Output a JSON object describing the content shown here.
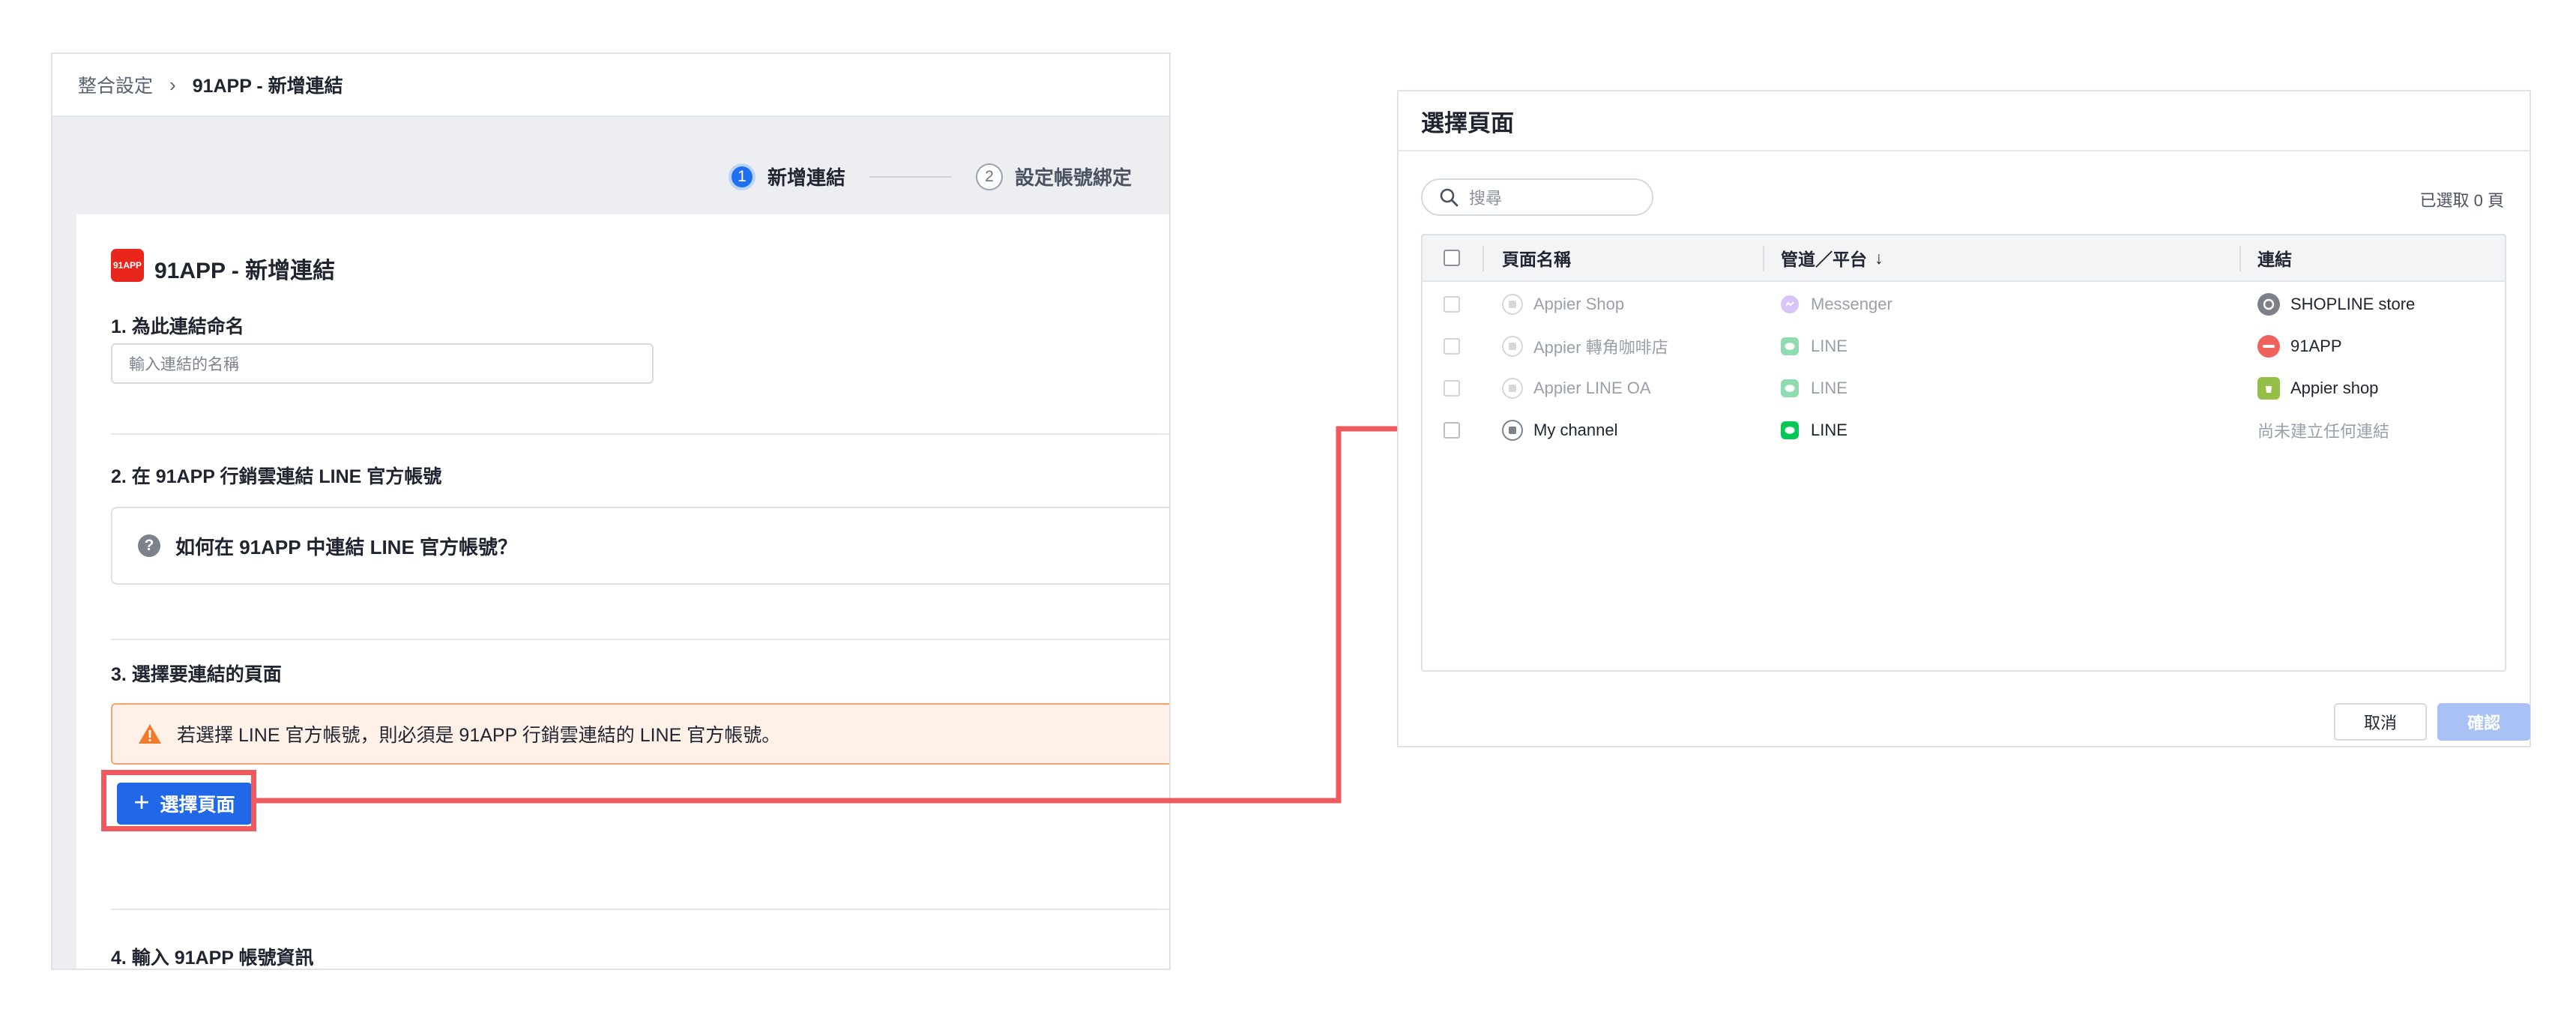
{
  "left_panel": {
    "breadcrumb": {
      "parent": "整合設定",
      "separator": "›",
      "current": "91APP - 新增連結"
    },
    "stepper": [
      {
        "num": "1",
        "label": "新增連結"
      },
      {
        "num": "2",
        "label": "設定帳號綁定"
      }
    ],
    "card": {
      "logo_text": "91APP",
      "title": "91APP - 新增連結",
      "section1_label": "1. 為此連結命名",
      "name_placeholder": "輸入連結的名稱",
      "section2_label": "2. 在 91APP 行銷雲連結 LINE 官方帳號",
      "help_text": "如何在 91APP 中連結 LINE 官方帳號？",
      "section3_label": "3. 選擇要連結的頁面",
      "warning_text": "若選擇 LINE 官方帳號，則必須是 91APP 行銷雲連結的 LINE 官方帳號。",
      "select_button": "選擇頁面",
      "section4_label": "4. 輸入 91APP 帳號資訊"
    }
  },
  "modal": {
    "title": "選擇頁面",
    "search_placeholder": "搜尋",
    "selected_count": "已選取 0 頁",
    "columns": {
      "page_name": "頁面名稱",
      "channel": "管道／平台",
      "sort_arrow": "↓",
      "connection": "連結"
    },
    "rows": [
      {
        "page": "Appier Shop",
        "channel": "Messenger",
        "channel_icon": "messenger-icon",
        "connection": "SHOPLINE store",
        "connection_icon": "shopline-icon",
        "disabled": true
      },
      {
        "page": "Appier 轉角咖啡店",
        "channel": "LINE",
        "channel_icon": "line-icon",
        "connection": "91APP",
        "connection_icon": "91app-icon",
        "disabled": true
      },
      {
        "page": "Appier LINE OA",
        "channel": "LINE",
        "channel_icon": "line-icon",
        "connection": "Appier shop",
        "connection_icon": "shopify-icon",
        "disabled": true
      },
      {
        "page": "My channel",
        "channel": "LINE",
        "channel_icon": "line-icon",
        "connection": "尚未建立任何連結",
        "connection_icon": "",
        "disabled": false
      }
    ],
    "cancel_label": "取消",
    "confirm_label": "確認"
  },
  "colors": {
    "primary": "#2168e8",
    "highlight": "#f05a5f",
    "warning_bg": "#fff1e8",
    "warning_border": "#f2a56f",
    "line_green": "#06c755",
    "brand_red": "#e8261c"
  }
}
